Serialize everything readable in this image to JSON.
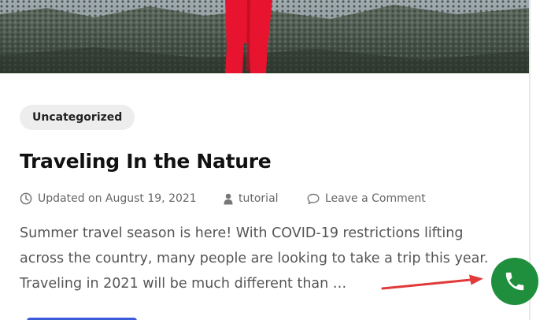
{
  "post": {
    "category": "Uncategorized",
    "title": "Traveling In the Nature",
    "meta": {
      "updated": "Updated on August 19, 2021",
      "author": "tutorial",
      "comments": "Leave a Comment"
    },
    "excerpt_lines": [
      "Summer travel season is here! With COVID-19 restrictions lifting",
      "across the country, many people are looking to take a trip this year.",
      "Traveling in 2021 will be much different than …"
    ]
  },
  "icons": {
    "updated": "clock-icon",
    "author": "user-icon",
    "comments": "comment-icon",
    "call": "phone-icon"
  },
  "colors": {
    "call_button": "#1f8f3d",
    "annotation_arrow": "#e03a3a",
    "read_more_button": "#3b5bdb",
    "jacket": "#e8142f"
  }
}
